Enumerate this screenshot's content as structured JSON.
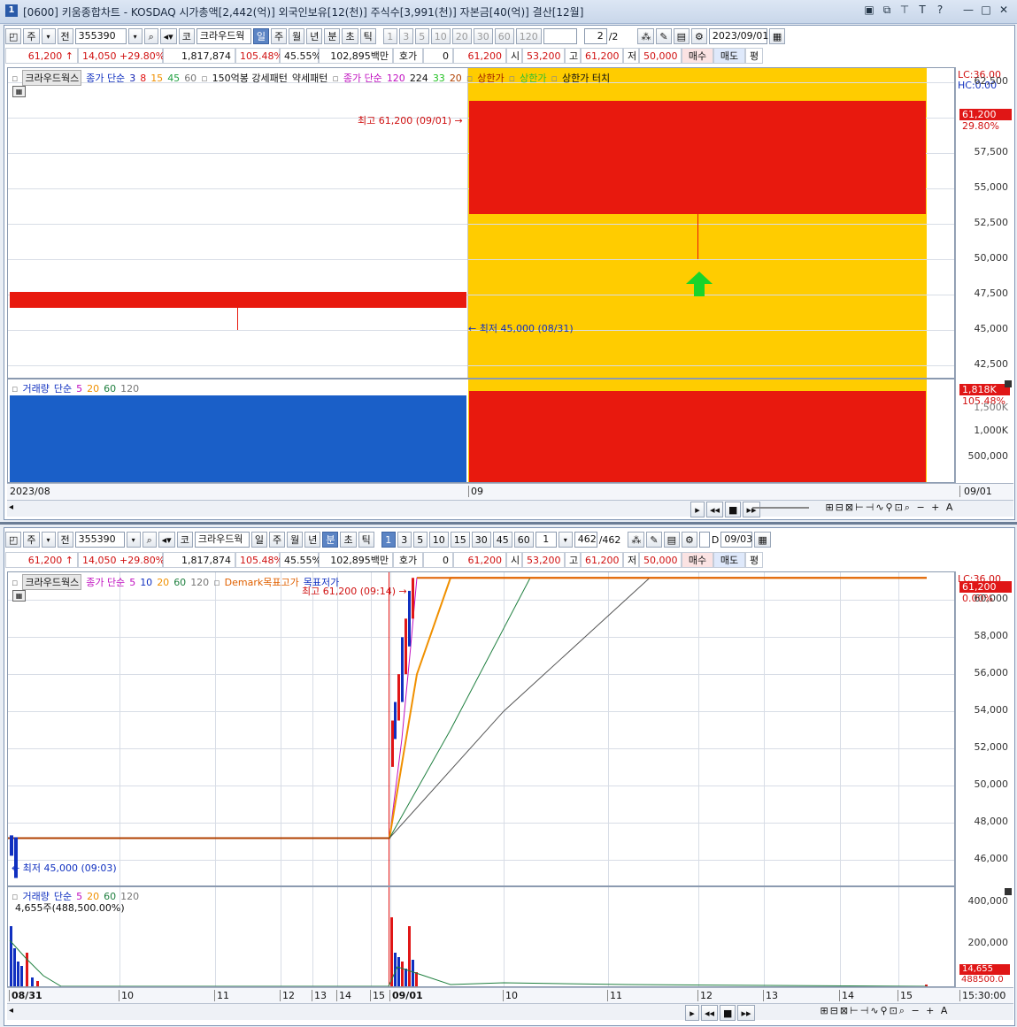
{
  "window": {
    "number": "1",
    "title": "[0600] 키움종합차트 - KOSDAQ 시가총액[2,442(억)] 외국인보유[12(천)] 주식수[3,991(천)] 자본금[40(억)] 결산[12월]",
    "icons": [
      "layout-icon",
      "restore-icon",
      "pin-icon",
      "font-icon",
      "help-icon",
      "minimize-icon",
      "maximize-icon",
      "close-icon"
    ]
  },
  "quote": {
    "price": "61,200",
    "arrow": "↑",
    "change": "14,050",
    "change_pct": "+29.80%",
    "volume": "1,817,874",
    "vol_ratio": "105.48%",
    "turnover": "45.55%",
    "amount": "102,895백만",
    "hoga_label": "호가",
    "hoga_value": "0",
    "current": "61,200",
    "open_label": "시",
    "open": "53,200",
    "high_label": "고",
    "high": "61,200",
    "low_label": "저",
    "low": "50,000",
    "buy": "매수",
    "sell": "매도",
    "avg": "평"
  },
  "chart1": {
    "toolbar": {
      "periods": [
        "주",
        "전"
      ],
      "code": "355390",
      "name": "크라우드웍",
      "prefix": "코",
      "units": [
        "일",
        "주",
        "월",
        "년",
        "분",
        "초",
        "틱"
      ],
      "active_unit": "일",
      "nums": [
        "1",
        "3",
        "5",
        "10",
        "20",
        "30",
        "60",
        "120"
      ],
      "page": "2",
      "page_total": "/2",
      "date": "2023/09/01"
    },
    "legend": {
      "name": "크라우드웍스",
      "ma_label": "종가 단순",
      "ma": [
        "3",
        "8",
        "15",
        "45",
        "60"
      ],
      "pattern1": "150억봉 강세패턴",
      "pattern2": "약세패턴",
      "ma2_label": "종가 단순",
      "ma2": [
        "120",
        "224",
        "33",
        "20"
      ],
      "limit1": "상한가",
      "limit2": "상한가",
      "limit3": "상한가 터치"
    },
    "y_axis": [
      "62,500",
      "60,000",
      "57,500",
      "55,000",
      "52,500",
      "50,000",
      "47,500",
      "45,000",
      "42,500"
    ],
    "lc": "LC:36.00",
    "hc": "HC:0.00",
    "last_tag": "61,200",
    "last_pct": "29.80%",
    "high_note": "최고 61,200 (09/01)",
    "low_note": "최저 45,000 (08/31)",
    "volume_legend": {
      "label": "거래량",
      "ma_label": "단순",
      "ma": [
        "5",
        "20",
        "60",
        "120"
      ]
    },
    "vol_axis": [
      "1,500K",
      "1,000K",
      "500,000"
    ],
    "vol_tag": "1,818K",
    "vol_pct": "105.48%",
    "x_labels": [
      "2023/08",
      "09",
      "09/01"
    ],
    "chart_data": {
      "type": "candlestick",
      "categories": [
        "08/31",
        "09/01"
      ],
      "open": [
        47150,
        53200
      ],
      "high": [
        47150,
        61200
      ],
      "low": [
        45000,
        50000
      ],
      "close": [
        47150,
        61200
      ],
      "volume": [
        0,
        1817874
      ],
      "ylim": [
        41500,
        63500
      ]
    }
  },
  "chart2": {
    "toolbar": {
      "periods": [
        "주",
        "전"
      ],
      "code": "355390",
      "name": "크라우드웍",
      "prefix": "코",
      "units": [
        "일",
        "주",
        "월",
        "년",
        "분",
        "초",
        "틱"
      ],
      "active_unit": "분",
      "nums": [
        "1",
        "3",
        "5",
        "10",
        "15",
        "30",
        "45",
        "60"
      ],
      "active_num": "1",
      "interval": "1",
      "page": "462",
      "page_total": "/462",
      "d_label": "D",
      "date": "09/03"
    },
    "legend": {
      "name": "크라우드웍스",
      "ma_label": "종가 단순",
      "ma": [
        "5",
        "10",
        "20",
        "60",
        "120"
      ],
      "demark": "Demark목표고가",
      "demark2": "목표저가"
    },
    "y_axis": [
      "60,000",
      "58,000",
      "56,000",
      "54,000",
      "52,000",
      "50,000",
      "48,000",
      "46,000"
    ],
    "lc": "LC:36.00",
    "last_tag": "61,200",
    "last_pct": "0.00%",
    "high_note": "최고 61,200 (09:14)",
    "low_note": "최저 45,000 (09:03)",
    "volume_legend": {
      "label": "거래량",
      "ma_label": "단순",
      "ma": [
        "5",
        "20",
        "60",
        "120"
      ],
      "note": "4,655주(488,500.00%)"
    },
    "vol_axis": [
      "400,000",
      "200,000"
    ],
    "vol_tag": "14,655",
    "vol_tag2": "488500.0",
    "x_labels": [
      "08/31",
      "10",
      "11",
      "12",
      "13",
      "14",
      "15",
      "09/01",
      "10",
      "11",
      "12",
      "13",
      "14",
      "15",
      "15:30:00"
    ],
    "chart_data": {
      "type": "line",
      "series": [
        {
          "name": "종가 단순 5",
          "x": [
            "08/31 15:30",
            "09/01 09:00",
            "09/01 09:05",
            "09/01 09:10",
            "09/01 09:14",
            "09/01 15:30"
          ],
          "y": [
            47150,
            47150,
            52500,
            57500,
            61200,
            61200
          ]
        },
        {
          "name": "종가 단순 20",
          "x": [
            "08/31 15:30",
            "09/01 09:00",
            "09/01 09:14",
            "09/01 09:30",
            "09/01 15:30"
          ],
          "y": [
            47150,
            47150,
            56000,
            61200,
            61200
          ]
        },
        {
          "name": "종가 단순 60",
          "x": [
            "08/31 15:30",
            "09/01 09:00",
            "09/01 09:30",
            "09/01 10:05",
            "09/01 15:30"
          ],
          "y": [
            47150,
            47150,
            53000,
            61200,
            61200
          ]
        },
        {
          "name": "종가 단순 120",
          "x": [
            "08/31 15:30",
            "09/01 09:00",
            "09/01 10:00",
            "09/01 11:05",
            "09/01 15:30"
          ],
          "y": [
            47150,
            47150,
            54000,
            61200,
            61200
          ]
        }
      ],
      "ylim": [
        44500,
        61500
      ]
    }
  }
}
